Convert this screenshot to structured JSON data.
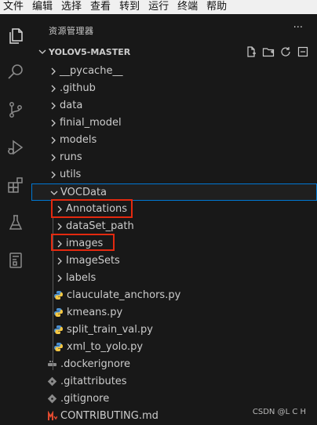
{
  "menu": [
    "文件",
    "编辑",
    "选择",
    "查看",
    "转到",
    "运行",
    "终端",
    "帮助"
  ],
  "activity_icons": [
    "explorer-icon",
    "search-icon",
    "source-control-icon",
    "run-debug-icon",
    "extensions-icon",
    "testing-icon",
    "remote-explorer-icon"
  ],
  "sidebar": {
    "title": "资源管理器",
    "more": "···",
    "section": "YOLOV5-MASTER"
  },
  "tree": [
    {
      "label": "__pycache__",
      "type": "folder"
    },
    {
      "label": ".github",
      "type": "folder"
    },
    {
      "label": "data",
      "type": "folder"
    },
    {
      "label": "finial_model",
      "type": "folder"
    },
    {
      "label": "models",
      "type": "folder"
    },
    {
      "label": "runs",
      "type": "folder"
    },
    {
      "label": "utils",
      "type": "folder"
    },
    {
      "label": "VOCData",
      "type": "folder-open"
    },
    {
      "label": "Annotations",
      "type": "folder"
    },
    {
      "label": "dataSet_path",
      "type": "folder"
    },
    {
      "label": "images",
      "type": "folder"
    },
    {
      "label": "ImageSets",
      "type": "folder"
    },
    {
      "label": "labels",
      "type": "folder"
    },
    {
      "label": "clauculate_anchors.py",
      "type": "python"
    },
    {
      "label": "kmeans.py",
      "type": "python"
    },
    {
      "label": "split_train_val.py",
      "type": "python"
    },
    {
      "label": "xml_to_yolo.py",
      "type": "python"
    },
    {
      "label": ".dockerignore",
      "type": "docker"
    },
    {
      "label": ".gitattributes",
      "type": "git"
    },
    {
      "label": ".gitignore",
      "type": "git"
    },
    {
      "label": "CONTRIBUTING.md",
      "type": "markdown"
    }
  ],
  "watermark": "CSDN @L C H",
  "colors": {
    "accent": "#0078d4",
    "highlight": "#e3290f",
    "python": "#4a8fd0",
    "git": "#8a8a8a",
    "docker": "#8a8a8a",
    "markdown": "#e04a2f"
  }
}
